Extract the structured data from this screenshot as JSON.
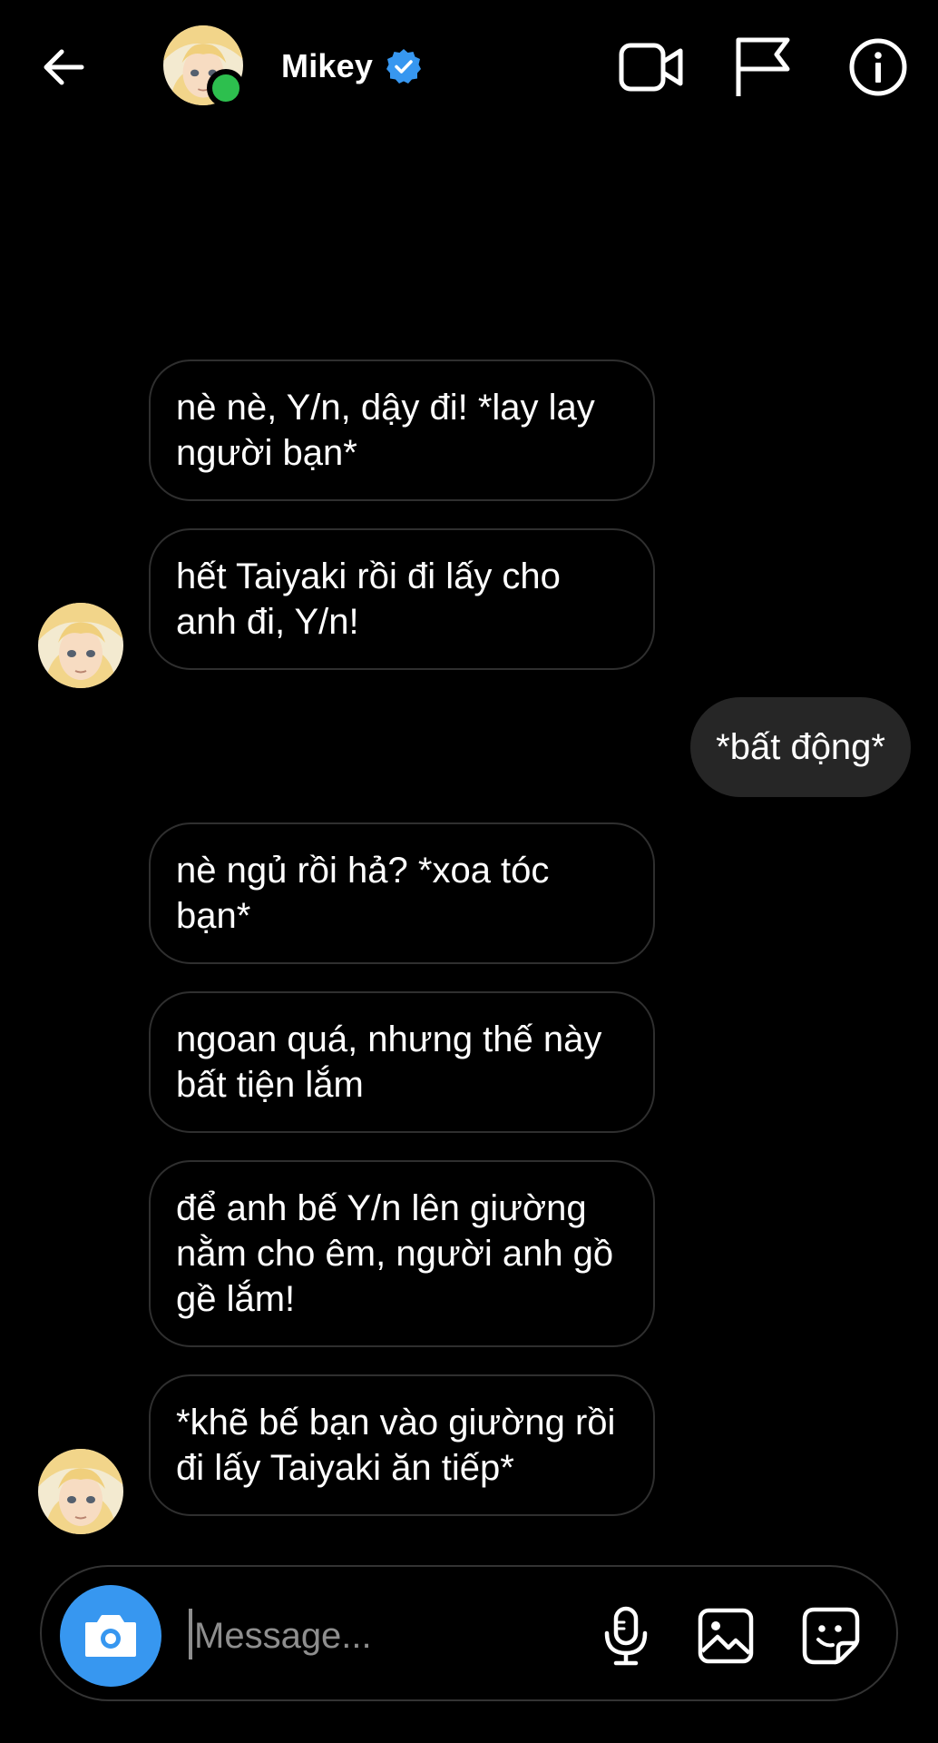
{
  "header": {
    "contact_name": "Mikey",
    "status": "online",
    "icons": [
      "back-arrow-icon",
      "verified-badge-icon",
      "video-call-icon",
      "report-flag-icon",
      "info-icon"
    ]
  },
  "messages": [
    {
      "from": "contact",
      "text": "nè nè, Y/n, dậy đi! *lay lay người bạn*"
    },
    {
      "from": "contact",
      "text": "hết Taiyaki rồi đi lấy cho anh đi, Y/n!"
    },
    {
      "from": "me",
      "text": "*bất động*"
    },
    {
      "from": "contact",
      "text": "nè ngủ rồi hả? *xoa tóc bạn*"
    },
    {
      "from": "contact",
      "text": "ngoan quá, nhưng thế này bất tiện lắm"
    },
    {
      "from": "contact",
      "text": "để anh bế Y/n lên giường nằm cho êm, người anh gồ gề lắm!"
    },
    {
      "from": "contact",
      "text": "*khẽ bế bạn vào giường rồi đi lấy Taiyaki ăn tiếp*"
    }
  ],
  "composer": {
    "placeholder": "Message...",
    "value": "",
    "icons": [
      "camera-icon",
      "microphone-icon",
      "gallery-icon",
      "sticker-icon"
    ]
  },
  "colors": {
    "background": "#000000",
    "accent": "#3797f0",
    "online": "#2dbf4e",
    "outgoing_bubble": "#262626",
    "incoming_border": "#2f2f2f"
  }
}
